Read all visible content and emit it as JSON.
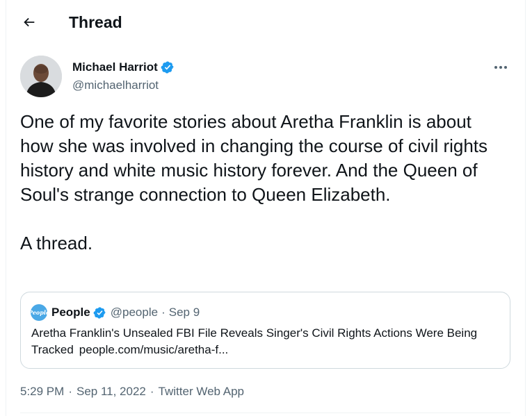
{
  "header": {
    "title": "Thread"
  },
  "author": {
    "name": "Michael Harriot",
    "handle": "@michaelharriot"
  },
  "tweet": {
    "paragraphs": [
      "One of my favorite stories about Aretha Franklin is about how she was involved in changing the course of civil rights history and white music history forever. And the Queen of Soul's strange connection to Queen Elizabeth.",
      "A thread."
    ]
  },
  "quote": {
    "avatar_text": "People",
    "name": "People",
    "handle": "@people",
    "separator": "·",
    "date": "Sep 9",
    "text": "Aretha Franklin's Unsealed FBI File Reveals Singer's Civil Rights Actions Were Being Tracked",
    "link": "people.com/music/aretha-f..."
  },
  "meta": {
    "time": "5:29 PM",
    "date": "Sep 11, 2022",
    "source": "Twitter Web App",
    "separator": "·"
  },
  "colors": {
    "verified": "#1d9bf0",
    "secondary_text": "#536471",
    "border": "#cfd9de",
    "people_brand": "#4aa8e6"
  },
  "icons": {
    "back": "arrow-left-icon",
    "verified": "verified-badge-icon",
    "more": "more-horizontal-icon"
  }
}
